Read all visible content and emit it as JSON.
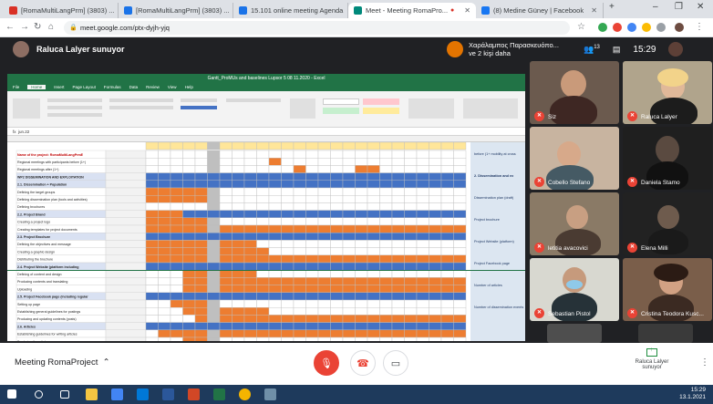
{
  "browser": {
    "tabs": [
      {
        "label": "[RomaMultiLangPrm] (3803) ..."
      },
      {
        "label": "[RomaMultiLangPrm] (3803) ..."
      },
      {
        "label": "15.101 online meeting Agenda"
      },
      {
        "label": "Meet - Meeting RomaPro..."
      },
      {
        "label": "(8) Medine Güney | Facebook"
      }
    ],
    "url": "meet.google.com/ptx-dyjh-yjq",
    "time": "15:29"
  },
  "meet": {
    "presenter_label": "Raluca Lalyer sunuyor",
    "notification": "Χαράλαμπος Παρασκευόπο... ve 2 kişi daha",
    "participant_count": "13",
    "clock": "15:29",
    "meeting_name": "Meeting RomaProject",
    "presenting_label": "Raluca Lalyer sunuyor",
    "participants": [
      {
        "name": "Siz"
      },
      {
        "name": "Raluca Lalyer"
      },
      {
        "name": "Cobello Stefano"
      },
      {
        "name": "Daniela Stamo"
      },
      {
        "name": "letitia avacovici"
      },
      {
        "name": "Elena Milli"
      },
      {
        "name": "Sebastian Pistol"
      },
      {
        "name": "Cristina Teodora Kusc..."
      }
    ]
  },
  "excel": {
    "title": "Gantt_ProMUs and baselines Lupsor 5 08 11.2020 - Excel",
    "menus": [
      "File",
      "Home",
      "Insert",
      "Page Layout",
      "Formulas",
      "Data",
      "Review",
      "View",
      "Help"
    ],
    "formula": "jun.22",
    "side_notes": [
      "before (1+ mobility at cross",
      "2. Dissemination and ex",
      "Dissemination plan (draft)",
      "Project brochure",
      "Project Website (platform)",
      "Project Facebook page",
      "Number of articles",
      "Number of dissemination events"
    ],
    "row_labels": [
      "Name of the project: RomaMultiLangPrmE",
      "Regional meetings with participants before (1+)",
      "Regional meetings after (1+)",
      "WP2 DISSEMINATION AND EXPLOITATION",
      "2.1. Dissemination + Population",
      "Defining the target groups",
      "Defining dissemination plan (tools and activities)",
      "Defining brochures",
      "2.2. Project Brand",
      "Creating a project logo",
      "Creating templates for project documents",
      "2.3. Project Brochure",
      "Defining the objectives and message",
      "Creating a graphic design",
      "Distributing the brochure",
      "2.4. Project Website (platform including",
      "Defining of content and design",
      "Producing contents and translating",
      "Uploading",
      "2.5. Project Facebook page (including regular",
      "Setting up page",
      "Establishing general guidelines for postings",
      "Producing and updating contents (posts)",
      "2.6. Articles",
      "Establishing guidelines for writing articles",
      "Producing the articles"
    ]
  }
}
